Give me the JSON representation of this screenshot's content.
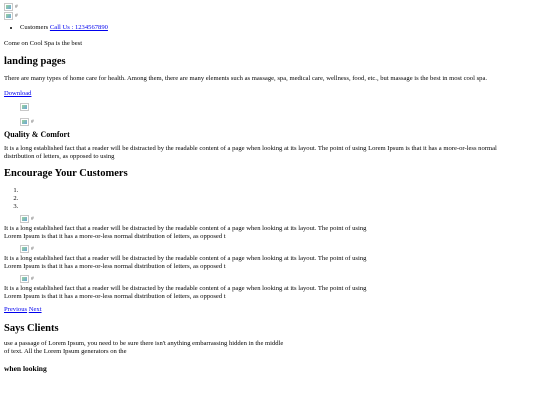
{
  "header": {
    "logo_alt": "#",
    "banner_alt": "#",
    "nav_label": "Customers",
    "phone_link": "Call Us : 1234567890"
  },
  "hero": {
    "tagline": "Come on Cool Spa is the best",
    "title": "landing pages",
    "intro": "There are many types of home care for health. Among them, there are many elements such as massage, spa, medical care, wellness, food, etc., but massage is the best in most cool spa.",
    "download_link": "Download"
  },
  "quality": {
    "image2_alt": "#",
    "title": "Quality & Comfort",
    "text": "It is a long established fact that a reader will be distracted by the readable content of a page when looking at its layout. The point of using Lorem Ipsum is that it has a more-or-less normal distribution of letters, as opposed to using"
  },
  "encourage": {
    "title": "Encourage Your Customers",
    "list_items": [
      "",
      "",
      ""
    ],
    "cards": [
      {
        "img_alt": "#",
        "text": "It is a long established fact that a reader will be distracted by the readable content of a page when looking at its layout. The point of using Lorem Ipsum is that it has a more-or-less normal distribution of letters, as opposed t"
      },
      {
        "img_alt": "#",
        "text": "It is a long established fact that a reader will be distracted by the readable content of a page when looking at its layout. The point of using Lorem Ipsum is that it has a more-or-less normal distribution of letters, as opposed t"
      },
      {
        "img_alt": "#",
        "text": "It is a long established fact that a reader will be distracted by the readable content of a page when looking at its layout. The point of using Lorem Ipsum is that it has a more-or-less normal distribution of letters, as opposed t"
      }
    ],
    "prev_link": "Previous",
    "next_link": "Next"
  },
  "clients": {
    "title": "Says Clients",
    "text": "use a passage of Lorem Ipsum, you need to be sure there isn't anything embarrassing hidden in the middle of text. All the Lorem Ipsum generators on the",
    "subtitle": "when looking"
  }
}
